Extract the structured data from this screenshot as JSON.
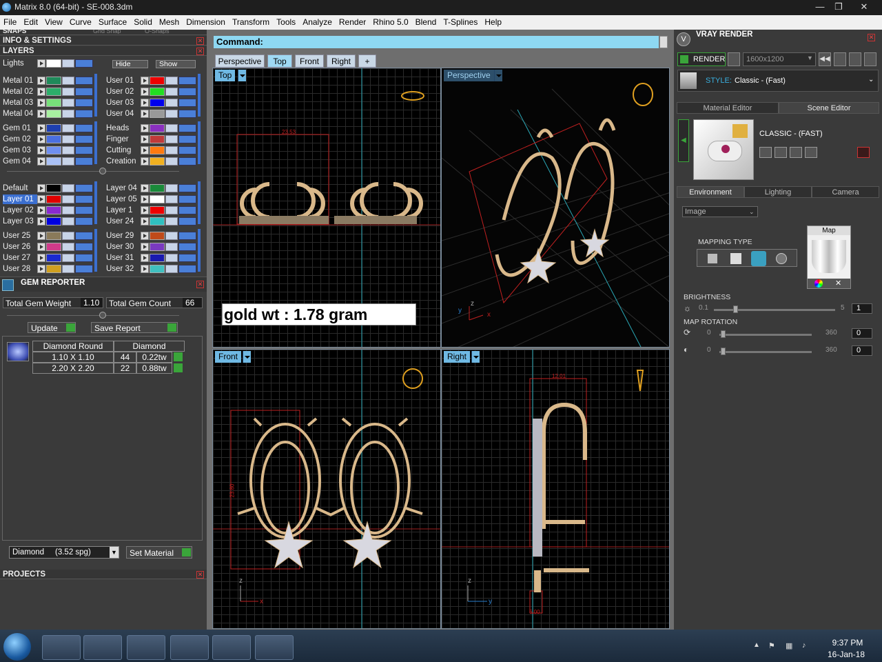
{
  "window": {
    "title": "Matrix 8.0 (64-bit) - SE-008.3dm",
    "min": "—",
    "max": "❐",
    "close": "✕"
  },
  "menu": [
    "File",
    "Edit",
    "View",
    "Curve",
    "Surface",
    "Solid",
    "Mesh",
    "Dimension",
    "Transform",
    "Tools",
    "Analyze",
    "Render",
    "Rhino 5.0",
    "Blend",
    "T-Splines",
    "Help"
  ],
  "left": {
    "snaps_title": "SNAPS",
    "snaps_partial": [
      "Grid Snap",
      "O-Snaps"
    ],
    "info_title": "INFO & SETTINGS",
    "layers_title": "LAYERS",
    "lights_label": "Lights",
    "hide_label": "Hide",
    "show_label": "Show",
    "layers_left": [
      {
        "name": "Metal 01",
        "color": "#1f8a5a"
      },
      {
        "name": "Metal 02",
        "color": "#2cae6a"
      },
      {
        "name": "Metal 03",
        "color": "#77e07a"
      },
      {
        "name": "Metal 04",
        "color": "#a8f0a0"
      },
      {
        "name": "Gem 01",
        "color": "#1e3fb0"
      },
      {
        "name": "Gem 02",
        "color": "#4a6fe0"
      },
      {
        "name": "Gem 03",
        "color": "#6f8ff0"
      },
      {
        "name": "Gem 04",
        "color": "#a9c0f5"
      },
      {
        "name": "Default",
        "color": "#000000"
      },
      {
        "name": "Layer 01",
        "color": "#e00000"
      },
      {
        "name": "Layer 02",
        "color": "#8a2ad0"
      },
      {
        "name": "Layer 03",
        "color": "#0000e0"
      },
      {
        "name": "User 25",
        "color": "#8a7a5a"
      },
      {
        "name": "User 26",
        "color": "#d03a8a"
      },
      {
        "name": "User 27",
        "color": "#1a2ad0"
      },
      {
        "name": "User 28",
        "color": "#d0a020"
      }
    ],
    "layers_right": [
      {
        "name": "User 01",
        "color": "#ee0000"
      },
      {
        "name": "User 02",
        "color": "#22dd22"
      },
      {
        "name": "User 03",
        "color": "#0000ee"
      },
      {
        "name": "User 04",
        "color": "#999999"
      },
      {
        "name": "Heads",
        "color": "#8a30c0"
      },
      {
        "name": "Finger",
        "color": "#c03a3a"
      },
      {
        "name": "Cutting",
        "color": "#ff7a10"
      },
      {
        "name": "Creation",
        "color": "#f0b020"
      },
      {
        "name": "Layer 04",
        "color": "#1a8a3a"
      },
      {
        "name": "Layer 05",
        "color": "#ffffff"
      },
      {
        "name": "Layer 1",
        "color": "#ee0000"
      },
      {
        "name": "User 24",
        "color": "#30c0c0"
      },
      {
        "name": "User 29",
        "color": "#c04a1a"
      },
      {
        "name": "User 30",
        "color": "#7a3ac0"
      },
      {
        "name": "User 31",
        "color": "#1a1ab0"
      },
      {
        "name": "User 32",
        "color": "#40c0c0"
      }
    ],
    "gem_reporter_title": "GEM REPORTER",
    "total_weight_label": "Total Gem Weight",
    "total_weight_value": "1.10",
    "total_count_label": "Total Gem Count",
    "total_count_value": "66",
    "update_label": "Update",
    "save_report_label": "Save Report",
    "gem_table": {
      "headers": [
        "Diamond Round",
        "Diamond"
      ],
      "rows": [
        {
          "size": "1.10 X 1.10",
          "count": "44",
          "weight": "0.22tw"
        },
        {
          "size": "2.20 X 2.20",
          "count": "22",
          "weight": "0.88tw"
        }
      ]
    },
    "material_select": "Diamond     (3.52 spg)",
    "set_material_label": "Set Material",
    "projects_title": "PROJECTS"
  },
  "center": {
    "command_label": "Command:",
    "tabs": [
      "Perspective",
      "Top",
      "Front",
      "Right",
      "+"
    ],
    "active_tab": "Top",
    "viewports": {
      "top": {
        "label": "Top",
        "annotation": "gold wt : 1.78 gram",
        "dim": "23.53"
      },
      "perspective": {
        "label": "Perspective"
      },
      "front": {
        "label": "Front",
        "dim": "23.80"
      },
      "right": {
        "label": "Right",
        "dim_top": "12.01",
        "dim_bottom": "6.00"
      }
    },
    "axes": {
      "x": "x",
      "y": "y",
      "z": "z"
    }
  },
  "right": {
    "title": "VRAY RENDER",
    "render_label": "RENDER",
    "resolution": "1600x1200",
    "style_label": "STYLE:",
    "style_value": "Classic - (Fast)",
    "tabs_top": [
      "Material Editor",
      "Scene Editor"
    ],
    "preset_name": "CLASSIC - (FAST)",
    "tabs_env": [
      "Environment",
      "Lighting",
      "Camera"
    ],
    "env_dropdown": "Image",
    "mapping_type_label": "MAPPING TYPE",
    "map_label": "Map",
    "brightness_label": "BRIGHTNESS",
    "brightness_min": "0.1",
    "brightness_max": "5",
    "brightness_value": "1",
    "map_rotation_label": "MAP ROTATION",
    "rot1_min": "0",
    "rot1_max": "360",
    "rot1_value": "0",
    "rot2_min": "0",
    "rot2_max": "360",
    "rot2_value": "0"
  },
  "taskbar": {
    "time": "9:37 PM",
    "date": "16-Jan-18"
  }
}
